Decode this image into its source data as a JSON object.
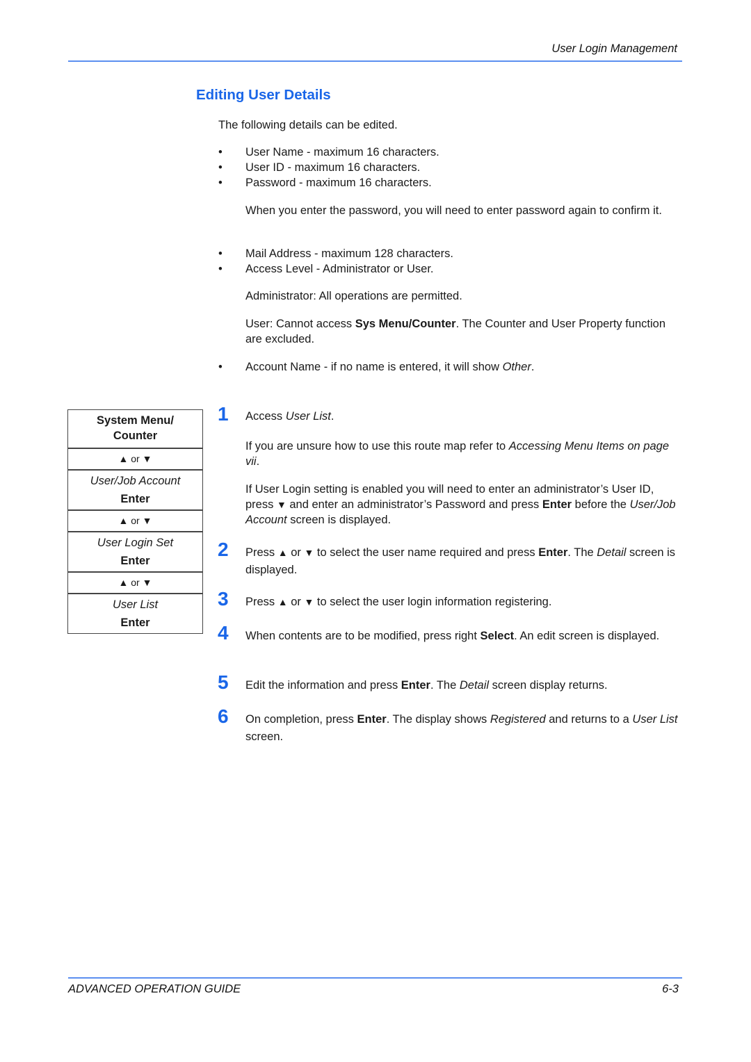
{
  "header": {
    "running_title": "User Login Management"
  },
  "section": {
    "title": "Editing User Details"
  },
  "intro": "The following details can be edited.",
  "fields": [
    {
      "bullet": "•",
      "text": "User Name - maximum 16 characters."
    },
    {
      "bullet": "•",
      "text": "User ID - maximum 16 characters."
    },
    {
      "bullet": "•",
      "text": "Password - maximum 16 characters."
    }
  ],
  "password_note": "When you enter the password, you will need to enter password again to confirm it.",
  "fields2": [
    {
      "bullet": "•",
      "text": "Mail Address - maximum 128 characters."
    },
    {
      "bullet": "•",
      "text": "Access Level - Administrator or User."
    }
  ],
  "admin_note": "Administrator: All operations are permitted.",
  "user_note": {
    "pre": "User: Cannot access ",
    "bold": "Sys Menu/Counter",
    "post": ". The Counter and User Property function are excluded."
  },
  "account_field": {
    "bullet": "•",
    "pre": "Account Name - if no name is entered, it will show ",
    "italic": "Other",
    "post": "."
  },
  "route_map": {
    "title_line1": "System Menu/",
    "title_line2": "Counter",
    "arrow_label": "or",
    "up_icon": "▲",
    "down_icon": "▼",
    "items": [
      {
        "label": "User/Job Account",
        "action": "Enter"
      },
      {
        "label": "User Login Set",
        "action": "Enter"
      },
      {
        "label": "User List",
        "action": "Enter"
      }
    ]
  },
  "steps": [
    {
      "number": "1",
      "main_pre": "Access ",
      "main_italic": "User List",
      "main_post": ".",
      "para1_pre": "If you are unsure how to use this route map refer to ",
      "para1_italic": "Accessing Menu Items on page vii",
      "para1_post": ".",
      "para2_a": "If User Login setting is enabled you will need to enter an administrator’s User ID, press ",
      "para2_icon": "▼",
      "para2_b": " and enter an administrator’s Password and press ",
      "para2_bold": "Enter",
      "para2_c": " before the ",
      "para2_italic": "User/Job Account",
      "para2_d": " screen is displayed."
    },
    {
      "number": "2",
      "a": "Press ",
      "up": "▲",
      "b": " or ",
      "down": "▼",
      "c": " to select the user name required and press ",
      "bold": "Enter",
      "d": ". The ",
      "italic": "Detail",
      "e": " screen is displayed."
    },
    {
      "number": "3",
      "a": "Press ",
      "up": "▲",
      "b": " or ",
      "down": "▼",
      "c": " to select the user login information registering."
    },
    {
      "number": "4",
      "a": "When contents are to be modified, press right ",
      "bold": "Select",
      "b": ". An edit screen is displayed."
    },
    {
      "number": "5",
      "a": "Edit the information and press ",
      "bold": "Enter",
      "b": ". The ",
      "italic": "Detail",
      "c": " screen display returns."
    },
    {
      "number": "6",
      "a": "On completion, press ",
      "bold": "Enter",
      "b": ". The display shows ",
      "italic": "Registered",
      "c": " and returns to a ",
      "italic2": "User List",
      "d": " screen."
    }
  ],
  "footer": {
    "guide_title": "ADVANCED OPERATION GUIDE",
    "page_number": "6-3"
  },
  "colors": {
    "accent": "#1a66e8",
    "rule": "#5b8ff0"
  }
}
